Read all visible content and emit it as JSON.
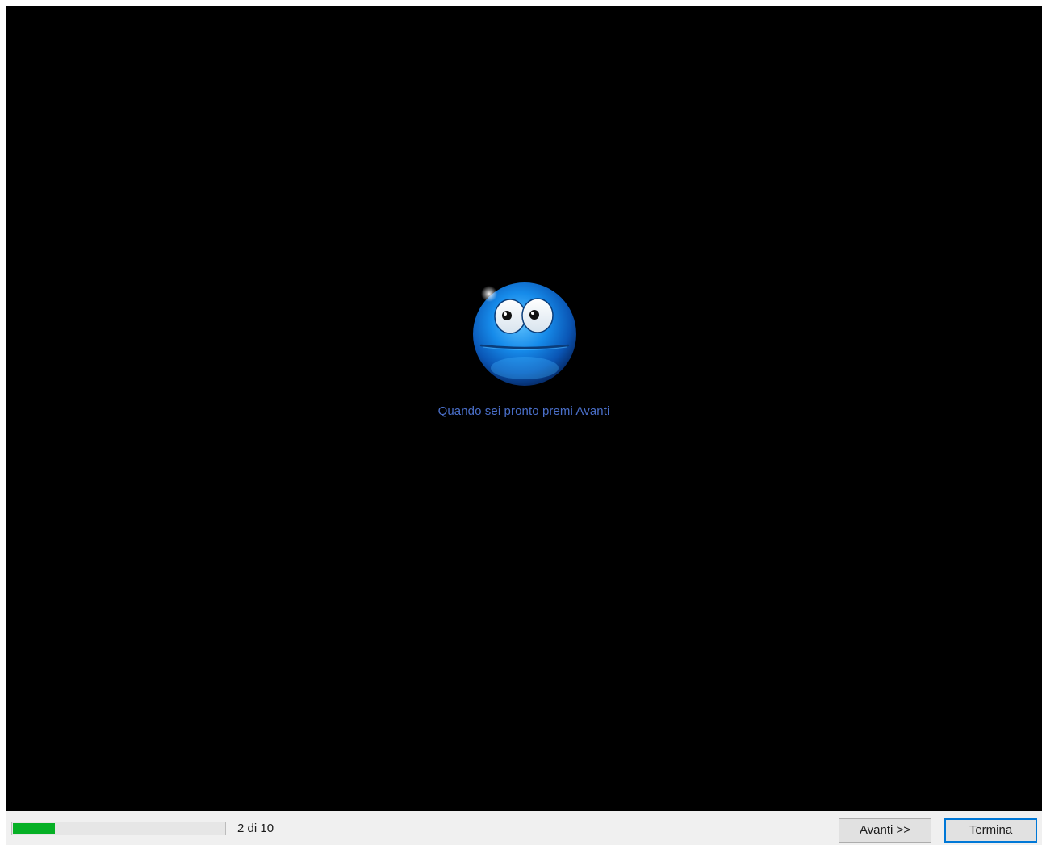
{
  "stage": {
    "prompt": "Quando sei pronto premi Avanti",
    "smiley_icon": "blue-smiley-face-icon",
    "background_color": "#000000",
    "prompt_color": "#4a6fc9"
  },
  "footer": {
    "progress": {
      "current": 2,
      "total": 10,
      "fraction": 0.2,
      "fill_color": "#06b025"
    },
    "step_text": "2 di 10",
    "next_button": "Avanti >>",
    "finish_button": "Termina"
  }
}
